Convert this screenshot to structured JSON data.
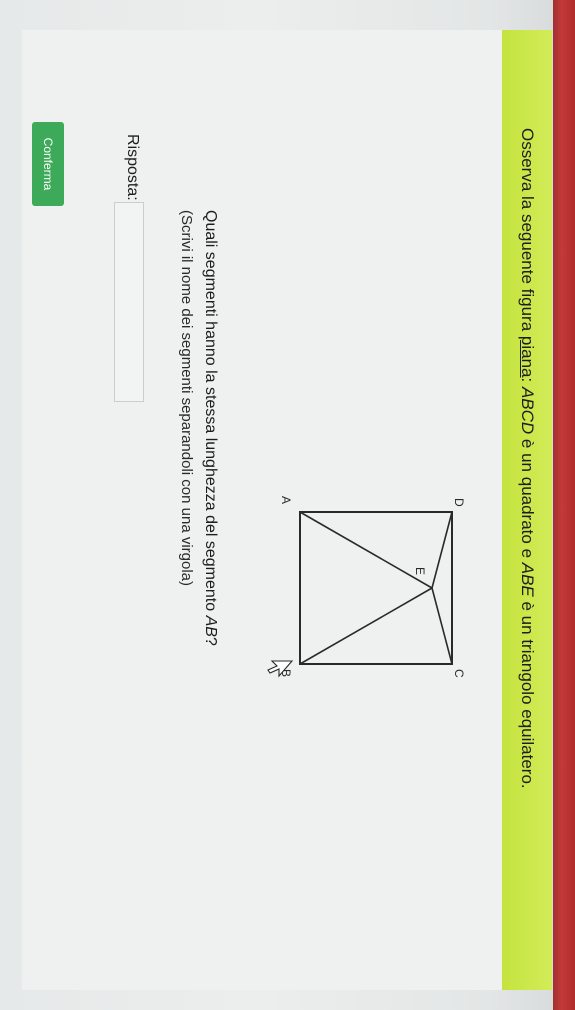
{
  "exercise": {
    "banner": {
      "prefix": "Osserva la seguente figura ",
      "underlined": "piana",
      "middle1": ": ",
      "square_name": "ABCD",
      "middle2": " è un quadrato e ",
      "triangle_name": "ABE",
      "suffix": " è un triangolo equilatero."
    },
    "figure": {
      "vertex_labels": {
        "A": "A",
        "B": "B",
        "C": "C",
        "D": "D",
        "E": "E"
      }
    },
    "question": {
      "prefix": "Quali segmenti hanno la stessa lunghezza del segmento ",
      "segment": "AB",
      "suffix": "?"
    },
    "hint": "(Scrivi il nome dei segmenti separandoli con una virgola)",
    "answer": {
      "label": "Risposta:",
      "value": "",
      "placeholder": ""
    },
    "confirm_label": "Conferma"
  },
  "colors": {
    "banner": "#c4e33e",
    "confirm_button": "#3daa5a",
    "page_background": "#eef1f0",
    "screen_edge": "#b02b2b"
  },
  "icons": [
    "mouse-cursor-icon"
  ]
}
